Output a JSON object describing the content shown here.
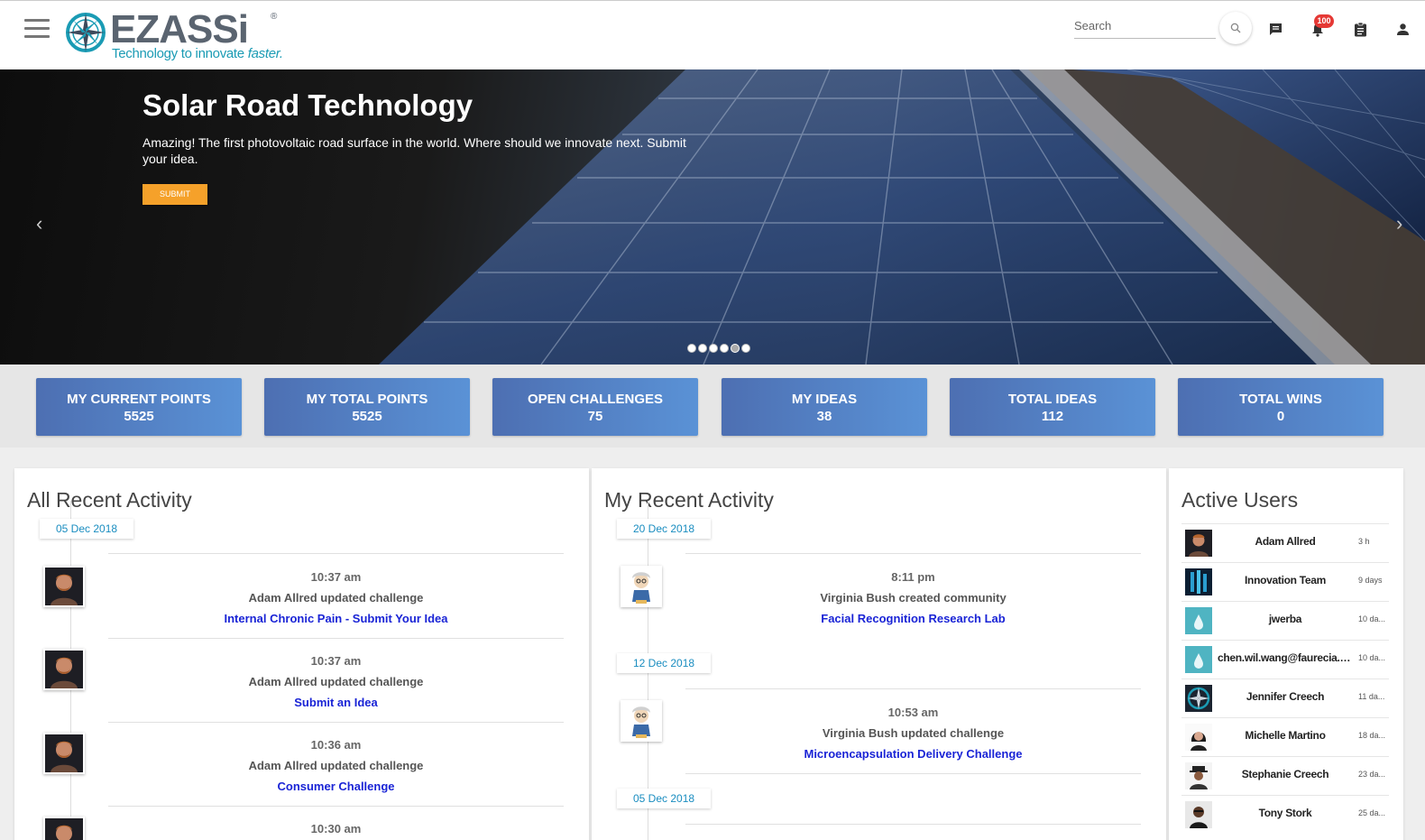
{
  "header": {
    "logo_text": "EZASSi",
    "logo_reg": "®",
    "tagline_prefix": "Technology to innovate ",
    "tagline_emph": "faster.",
    "search_placeholder": "Search",
    "notifications_count": "100",
    "icons": [
      "menu-icon",
      "search-icon",
      "chat-icon",
      "bell-icon",
      "clipboard-icon",
      "user-icon"
    ]
  },
  "hero": {
    "title": "Solar Road Technology",
    "text": "Amazing! The first photovoltaic road surface in the world. Where should we innovate next. Submit your idea.",
    "button_label": "SUBMIT",
    "prev_glyph": "‹",
    "next_glyph": "›",
    "slide_count": 6,
    "active_slide": 5
  },
  "stats": [
    {
      "label": "MY CURRENT POINTS",
      "value": "5525"
    },
    {
      "label": "MY TOTAL POINTS",
      "value": "5525"
    },
    {
      "label": "OPEN CHALLENGES",
      "value": "75"
    },
    {
      "label": "MY IDEAS",
      "value": "38"
    },
    {
      "label": "TOTAL IDEAS",
      "value": "112"
    },
    {
      "label": "TOTAL WINS",
      "value": "0"
    }
  ],
  "all_activity": {
    "title": "All Recent Activity",
    "date": "05 Dec 2018",
    "entries": [
      {
        "time": "10:37 am",
        "desc": "Adam Allred updated challenge",
        "link": "Internal Chronic Pain - Submit Your Idea"
      },
      {
        "time": "10:37 am",
        "desc": "Adam Allred updated challenge",
        "link": "Submit an Idea"
      },
      {
        "time": "10:36 am",
        "desc": "Adam Allred updated challenge",
        "link": "Consumer Challenge"
      },
      {
        "time": "10:30 am",
        "desc": "",
        "link": ""
      }
    ]
  },
  "my_activity": {
    "title": "My Recent Activity",
    "dates": [
      "20 Dec 2018",
      "12 Dec 2018",
      "05 Dec 2018"
    ],
    "entries": [
      {
        "time": "8:11 pm",
        "desc": "Virginia Bush created community",
        "link": "Facial Recognition Research Lab"
      },
      {
        "time": "10:53 am",
        "desc": "Virginia Bush updated challenge",
        "link": "Microencapsulation Delivery Challenge"
      }
    ]
  },
  "active_users": {
    "title": "Active Users",
    "users": [
      {
        "name": "Adam Allred",
        "time": "3 h"
      },
      {
        "name": "Innovation Team",
        "time": "9 days"
      },
      {
        "name": "jwerba",
        "time": "10 da..."
      },
      {
        "name": "chen.wil.wang@faurecia.c...",
        "time": "10 da..."
      },
      {
        "name": "Jennifer Creech",
        "time": "11 da..."
      },
      {
        "name": "Michelle Martino",
        "time": "18 da..."
      },
      {
        "name": "Stephanie Creech",
        "time": "23 da..."
      },
      {
        "name": "Tony Stork",
        "time": "25 da..."
      }
    ]
  },
  "colors": {
    "accent_orange": "#f5a12a",
    "stat_gradient_start": "#4d6fb2",
    "stat_gradient_end": "#5a92d6",
    "link_blue": "#1a24d6",
    "date_teal": "#1a8dc0",
    "badge_red": "#e53935",
    "logo_teal": "#1a9bb4"
  }
}
